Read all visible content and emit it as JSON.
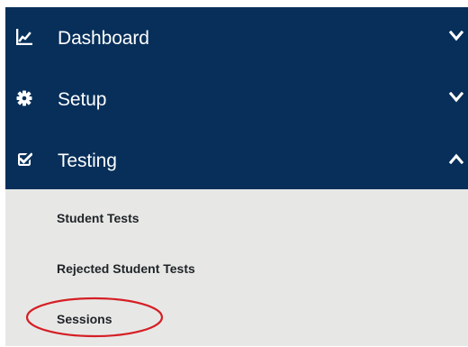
{
  "sidebar": {
    "items": [
      {
        "label": "Dashboard",
        "icon": "line-chart-icon",
        "state": "collapsed"
      },
      {
        "label": "Setup",
        "icon": "gear-icon",
        "state": "collapsed"
      },
      {
        "label": "Testing",
        "icon": "check-square-icon",
        "state": "expanded"
      }
    ],
    "submenu": [
      {
        "label": "Student Tests"
      },
      {
        "label": "Rejected Student Tests"
      },
      {
        "label": "Sessions"
      }
    ]
  },
  "colors": {
    "nav_background": "#072f5a",
    "submenu_background": "#e7e8e6",
    "nav_text": "#ffffff",
    "submenu_text": "#1f2327",
    "highlight": "#d51f25"
  }
}
